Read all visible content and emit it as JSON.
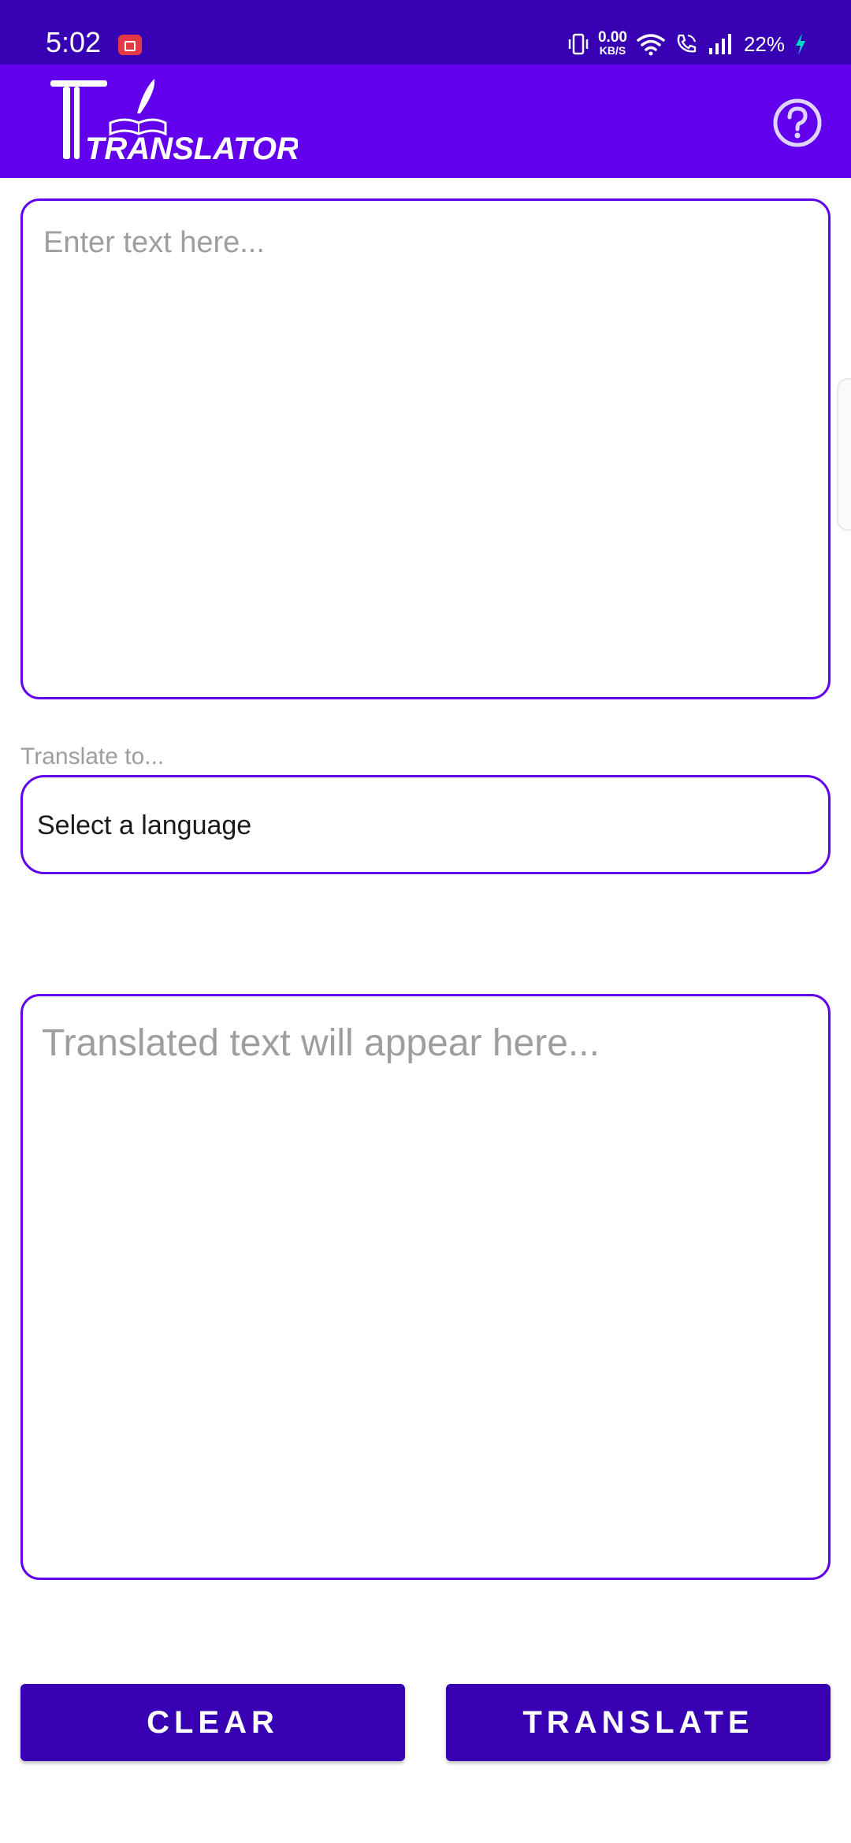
{
  "status_bar": {
    "time": "5:02",
    "net_speed_value": "0.00",
    "net_speed_unit": "KB/S",
    "battery": "22%",
    "icons": [
      "screen-record-icon",
      "vibrate-icon",
      "wifi-icon",
      "wifi-calling-icon",
      "signal-icon",
      "battery-charging-icon"
    ]
  },
  "app_bar": {
    "logo_text": "TRANSLATOR",
    "help_icon": "help-circle-icon"
  },
  "input": {
    "placeholder": "Enter text here..."
  },
  "language": {
    "label": "Translate to...",
    "selected": "Select a language"
  },
  "output": {
    "placeholder": "Translated text will appear here..."
  },
  "actions": {
    "clear_label": "CLEAR",
    "translate_label": "TRANSLATE"
  },
  "colors": {
    "status_bar": "#3700B3",
    "app_bar": "#6200EE",
    "border": "#6200EE",
    "button": "#3700B3",
    "placeholder": "#9E9E9E"
  }
}
